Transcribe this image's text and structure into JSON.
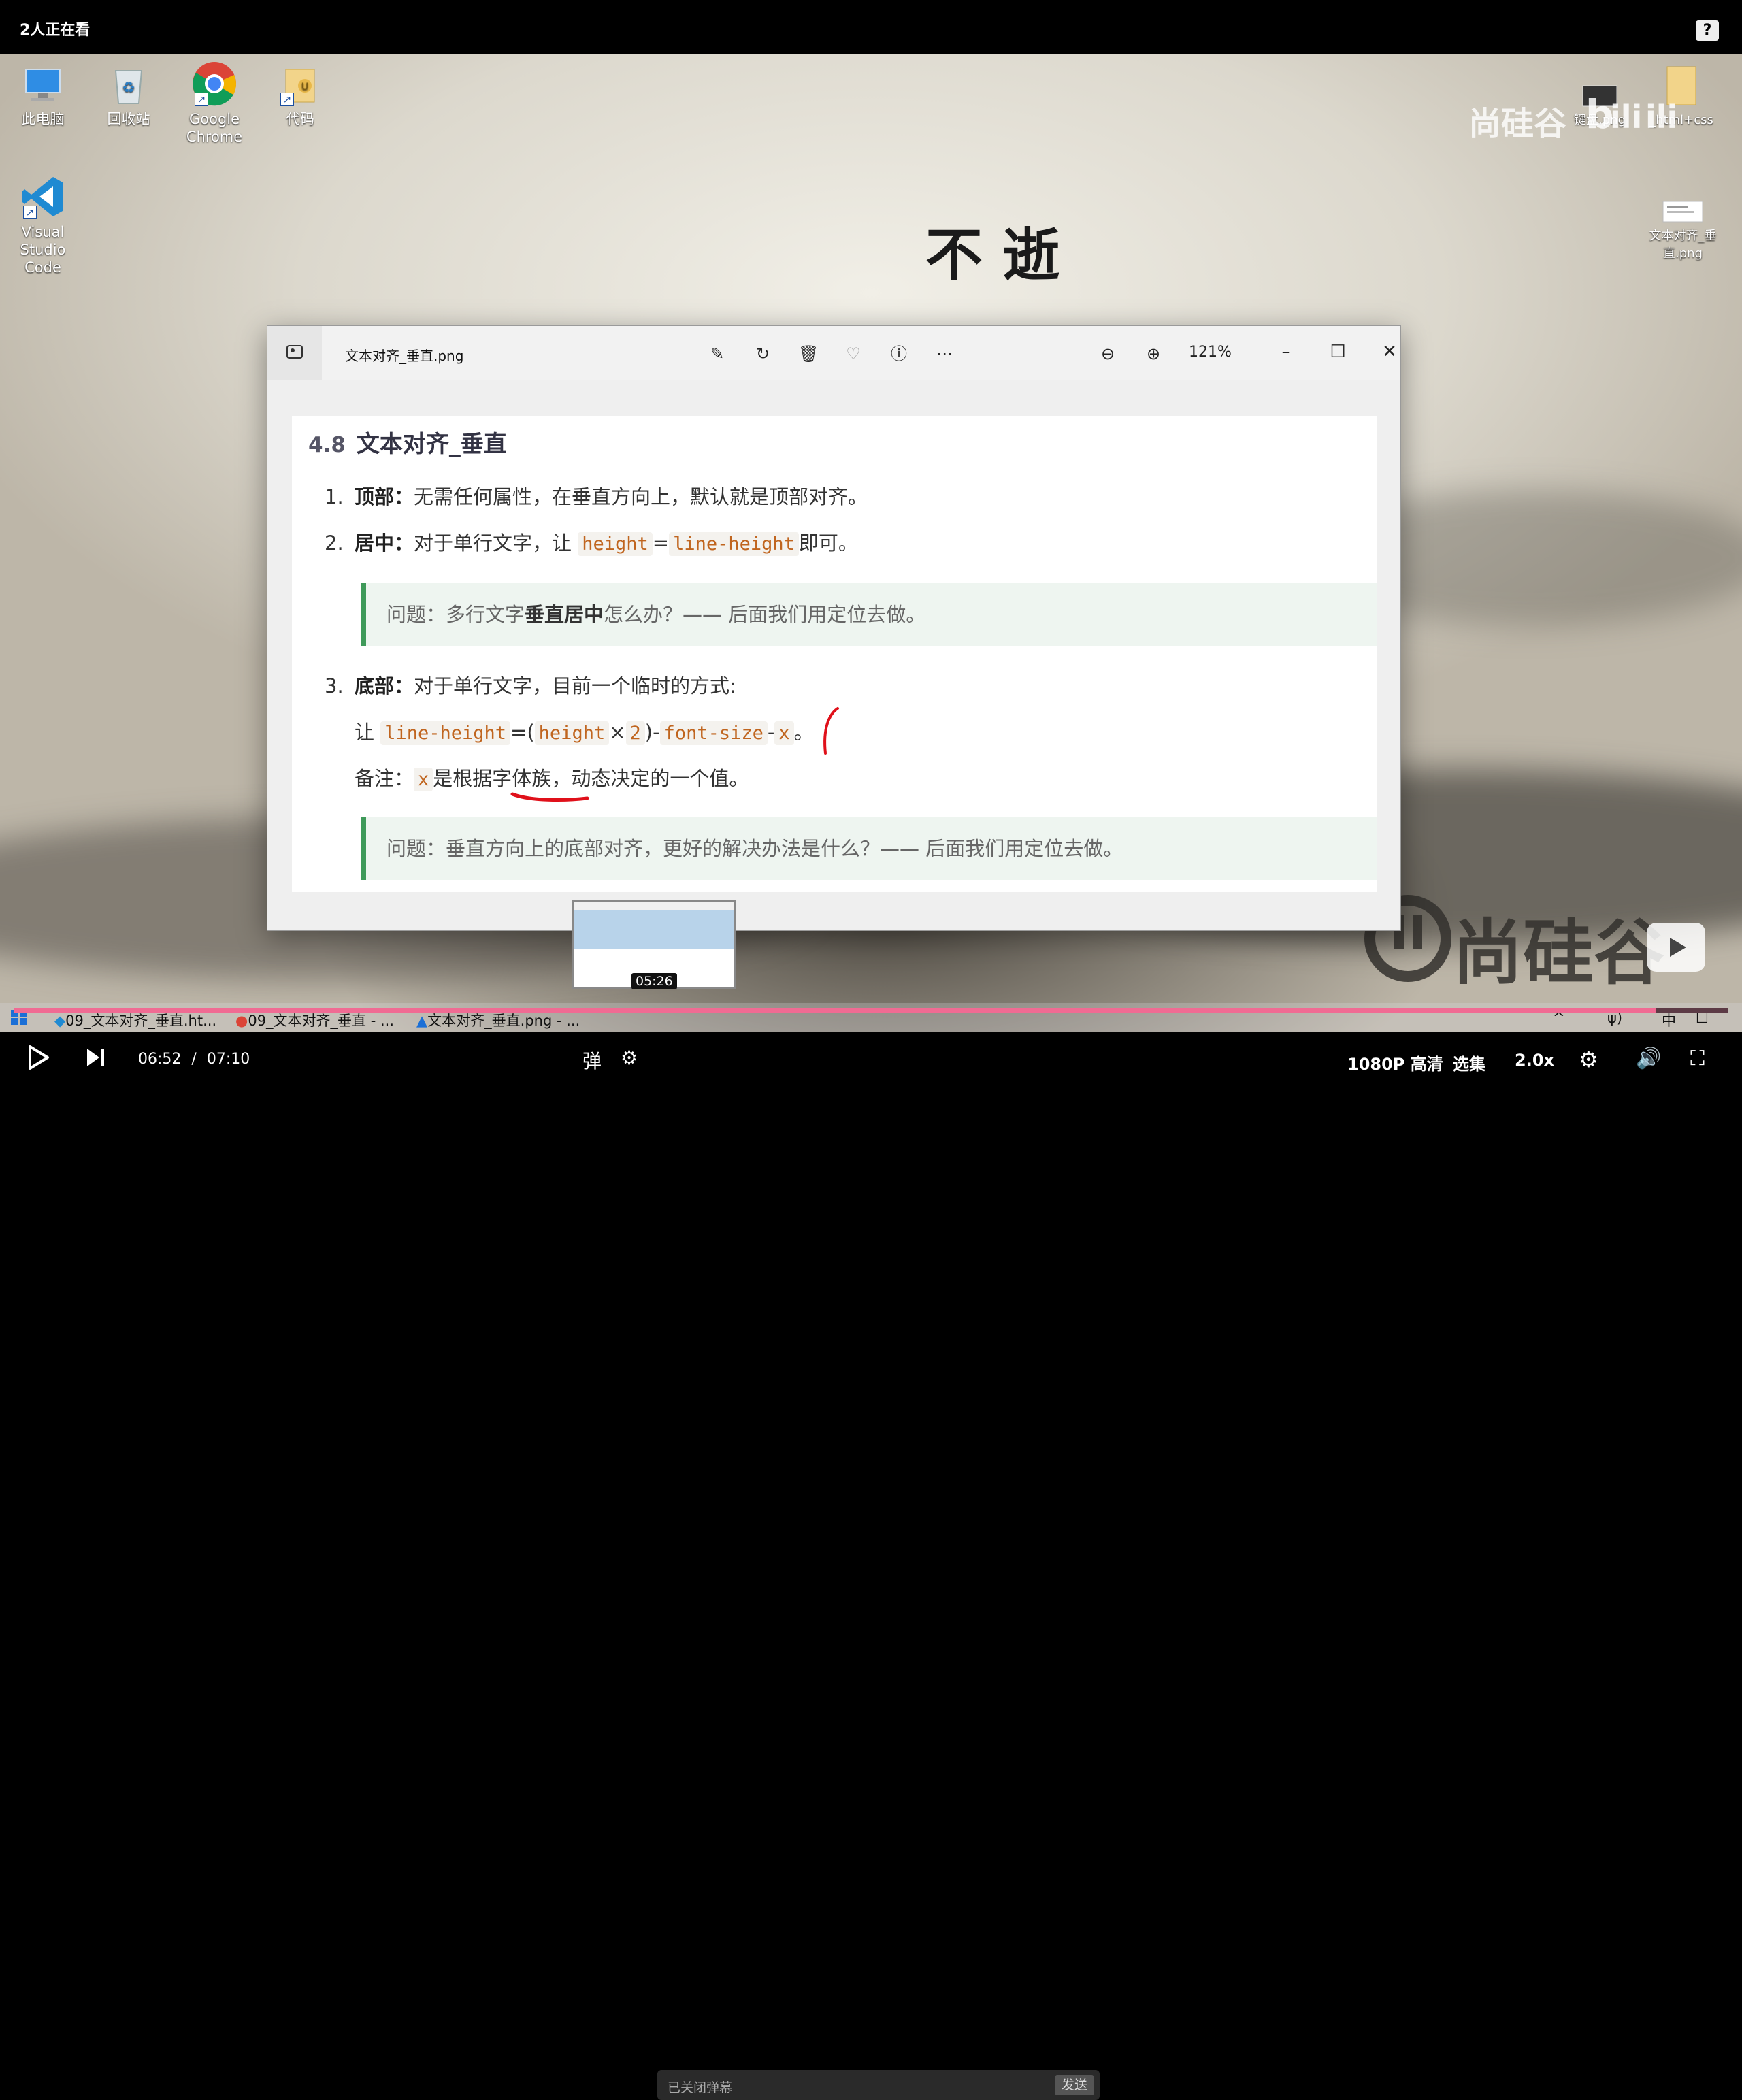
{
  "player": {
    "viewers": "2人正在看",
    "help": "?",
    "current_time": "06:52",
    "time_sep": "/",
    "duration": "07:10",
    "progress_fraction": 0.958,
    "danmaku_placeholder": "已关闭弹幕",
    "send_label": "发送",
    "quality_label": "1080P 高清",
    "episodes_label": "选集",
    "speed_label": "2.0x",
    "preview_time": "05:26"
  },
  "desktop": {
    "icons": [
      {
        "label": "此电脑"
      },
      {
        "label": "回收站"
      },
      {
        "label": "Google Chrome"
      },
      {
        "label": "代码"
      },
      {
        "label": "Visual Studio Code"
      },
      {
        "label": "键盘.png"
      },
      {
        "label": "_html+css"
      },
      {
        "label": "文本对齐_垂直.png"
      }
    ],
    "watermark_top": "尚硅谷",
    "watermark_bottom": "尚硅谷",
    "wallpaper_text": "不  逝"
  },
  "viewer": {
    "filename": "文本对齐_垂直.png",
    "zoom": "121%"
  },
  "doc": {
    "heading_num": "4.8",
    "heading": "文本对齐_垂直",
    "item1_num": "1.",
    "item1_bold": "顶部：",
    "item1_text": "无需任何属性，在垂直方向上，默认就是顶部对齐。",
    "item2_num": "2.",
    "item2_bold": "居中：",
    "item2_text": "对于单行文字，让",
    "item2_code1": "height",
    "item2_eq": "=",
    "item2_code2": "line-height",
    "item2_end": "即可。",
    "note1_pre": "问题：多行文字",
    "note1_bold": "垂直居中",
    "note1_post": "怎么办？—— 后面我们用定位去做。",
    "item3_num": "3.",
    "item3_bold": "底部：",
    "item3_text": "对于单行文字，目前一个临时的方式:",
    "f_let": "让",
    "f_code1": "line-height",
    "f_eq": "=(",
    "f_code2": "height",
    "f_times": "×",
    "f_code3": "2",
    "f_close": ")-",
    "f_code4": "font-size",
    "f_minus": "-",
    "f_code5": "x",
    "f_end": "。",
    "remark_label": "备注：",
    "remark_code": "x",
    "remark_text1": "是根据",
    "remark_underline": "字体族",
    "remark_text2": "，动态决定的一个值。",
    "note2": "问题：垂直方向上的底部对齐，更好的解决办法是什么？—— 后面我们用定位去做。"
  },
  "taskbar": {
    "items": [
      {
        "label": "09_文本对齐_垂直.ht..."
      },
      {
        "label": "09_文本对齐_垂直 - ..."
      },
      {
        "label": "文本对齐_垂直.png - ..."
      }
    ],
    "ime": "中",
    "vol": "ψ)"
  },
  "colors": {
    "accent": "#f06b93",
    "code": "#c0651f",
    "note_border": "#3f9a5a",
    "annotation": "#e0101a"
  }
}
